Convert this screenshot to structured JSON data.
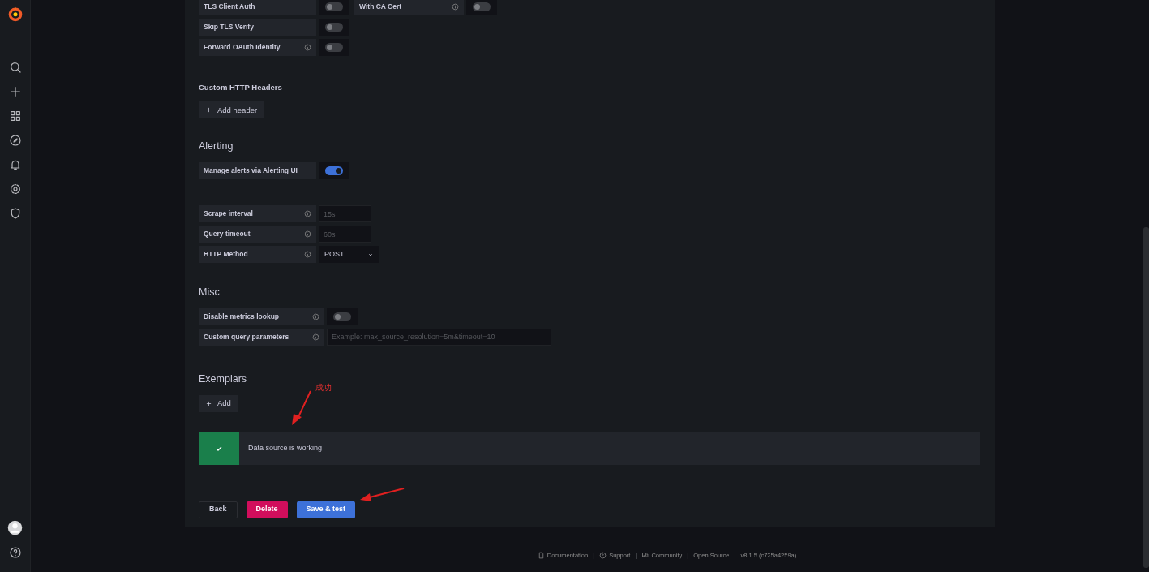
{
  "sections": [
    {
      "kind": "plain",
      "rows": [
        {
          "fields": [
            {
              "label": "TLS Client Auth",
              "info": false,
              "kind": "toggle",
              "on": false
            },
            {
              "label": "With CA Cert",
              "info": true,
              "kind": "toggle",
              "on": false
            }
          ]
        },
        {
          "fields": [
            {
              "label": "Skip TLS Verify",
              "info": false,
              "kind": "toggle",
              "on": false
            }
          ]
        },
        {
          "fields": [
            {
              "label": "Forward OAuth Identity",
              "info": true,
              "kind": "toggle",
              "on": false
            }
          ]
        }
      ]
    },
    {
      "kind": "subsection",
      "heading": "Custom HTTP Headers",
      "add_button": "Add header"
    },
    {
      "kind": "section",
      "heading": "Alerting",
      "rows": [
        {
          "fields": [
            {
              "label": "Manage alerts via Alerting UI",
              "info": false,
              "kind": "toggle",
              "on": true
            }
          ]
        }
      ]
    },
    {
      "kind": "plain",
      "rows": [
        {
          "fields": [
            {
              "label": "Scrape interval",
              "info": true,
              "kind": "input",
              "placeholder": "15s"
            }
          ]
        },
        {
          "fields": [
            {
              "label": "Query timeout",
              "info": true,
              "kind": "input",
              "placeholder": "60s"
            }
          ]
        },
        {
          "fields": [
            {
              "label": "HTTP Method",
              "info": true,
              "kind": "select",
              "value": "POST"
            }
          ]
        }
      ]
    },
    {
      "kind": "section",
      "heading": "Misc",
      "rows": [
        {
          "fields": [
            {
              "label": "Disable metrics lookup",
              "info": true,
              "kind": "toggle",
              "on": false
            }
          ]
        },
        {
          "fields": [
            {
              "label": "Custom query parameters",
              "info": true,
              "kind": "wideinput",
              "placeholder": "Example: max_source_resolution=5m&timeout=10"
            }
          ]
        }
      ]
    },
    {
      "kind": "section",
      "heading": "Exemplars",
      "add_button": "Add"
    }
  ],
  "alert": {
    "message": "Data source is working"
  },
  "buttons": [
    {
      "label": "Back",
      "kind": "secondary"
    },
    {
      "label": "Delete",
      "kind": "danger"
    },
    {
      "label": "Save & test",
      "kind": "primary"
    }
  ],
  "annotation": {
    "text": "成功"
  },
  "footer": [
    {
      "label": "Documentation",
      "kind": "docs"
    },
    {
      "label": "|",
      "kind": "separator"
    },
    {
      "label": "Support",
      "kind": "support"
    },
    {
      "label": "|",
      "kind": "separator"
    },
    {
      "label": "Community",
      "kind": "community"
    },
    {
      "label": "|",
      "kind": "separator"
    },
    {
      "label": "Open Source",
      "kind": "text"
    },
    {
      "label": "|",
      "kind": "separator"
    },
    {
      "label": "v8.1.5 (c725a4259a)",
      "kind": "text"
    }
  ]
}
